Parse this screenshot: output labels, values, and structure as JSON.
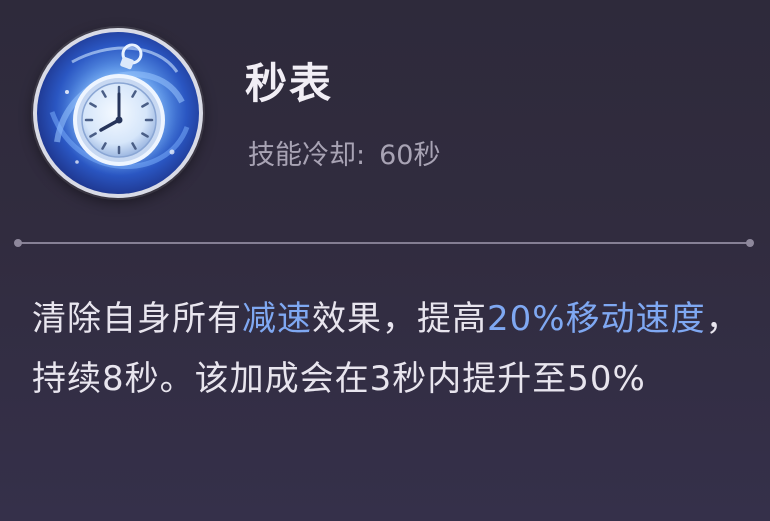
{
  "skill": {
    "name": "秒表",
    "icon": "stopwatch-icon",
    "cooldown_label": "技能冷却:",
    "cooldown_value": "60秒"
  },
  "description": {
    "segments": [
      {
        "text": "清除自身所有",
        "highlight": false
      },
      {
        "text": "减速",
        "highlight": true
      },
      {
        "text": "效果，提高",
        "highlight": false
      },
      {
        "text": "20%移动速度",
        "highlight": true
      },
      {
        "text": "，持续8秒。该加成会在3秒内提升至50%",
        "highlight": false
      }
    ]
  },
  "colors": {
    "background": "#312c3f",
    "highlight": "#7fa8f2",
    "title": "#f1eef5",
    "subtext": "#a8a3b4",
    "divider": "#8e889c"
  }
}
